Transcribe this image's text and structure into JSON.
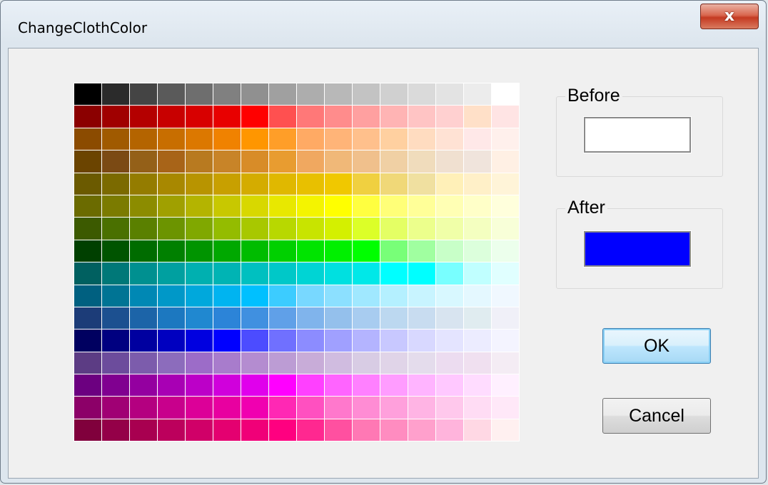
{
  "window": {
    "title": "ChangeClothColor",
    "close_icon": "x-icon",
    "close_glyph": "x"
  },
  "palette": {
    "rows": [
      [
        "#000000",
        "#2b2b2b",
        "#444444",
        "#5a5a5a",
        "#6e6e6e",
        "#808080",
        "#909090",
        "#a0a0a0",
        "#adadad",
        "#b8b8b8",
        "#c3c3c3",
        "#d0d0d0",
        "#dadada",
        "#e3e3e3",
        "#ececec",
        "#ffffff"
      ],
      [
        "#8b0000",
        "#a00000",
        "#b40000",
        "#c80000",
        "#d80000",
        "#e80000",
        "#ff0000",
        "#ff5050",
        "#ff7878",
        "#ff8c8c",
        "#ffa0a0",
        "#ffb4b4",
        "#ffc4c4",
        "#ffd0d0",
        "#ffe0c8",
        "#ffe4e4"
      ],
      [
        "#8b4b00",
        "#a05a00",
        "#b46400",
        "#c86e00",
        "#dc7800",
        "#f08200",
        "#ff9600",
        "#ff9e28",
        "#ffaa64",
        "#ffb478",
        "#ffc08c",
        "#ffd0a0",
        "#ffdcc0",
        "#ffe2d4",
        "#ffe8e8",
        "#fff0ec"
      ],
      [
        "#6b4400",
        "#7b4a14",
        "#946018",
        "#a86418",
        "#b87a20",
        "#c88428",
        "#d88c28",
        "#e89c30",
        "#f0a860",
        "#f0b878",
        "#f0c08c",
        "#f0d0a4",
        "#f0dcbc",
        "#f0e0d0",
        "#f0e4dc",
        "#fff0e4"
      ],
      [
        "#6b5a00",
        "#7b6a00",
        "#947c00",
        "#a88800",
        "#b89400",
        "#c8a000",
        "#d4ac00",
        "#e0b800",
        "#e8c000",
        "#f0c800",
        "#f0d040",
        "#f0d878",
        "#f0e0a0",
        "#fff0b8",
        "#fff0c8",
        "#fff4d8"
      ],
      [
        "#6b6b00",
        "#7b7b00",
        "#8c8c00",
        "#a0a000",
        "#b4b400",
        "#c8c800",
        "#d8d800",
        "#e8e800",
        "#f4f400",
        "#ffff00",
        "#ffff40",
        "#ffff78",
        "#ffff98",
        "#ffffb4",
        "#ffffc8",
        "#ffffdc"
      ],
      [
        "#3c5a00",
        "#4a7000",
        "#5a8000",
        "#6c9400",
        "#80a800",
        "#94bc00",
        "#a8c800",
        "#b8d800",
        "#c8e400",
        "#d4f000",
        "#dcff28",
        "#e4ff64",
        "#ecff8c",
        "#f0ffa8",
        "#f4ffc0",
        "#f8ffd8"
      ],
      [
        "#004000",
        "#005400",
        "#006c00",
        "#008000",
        "#009400",
        "#00a800",
        "#00bc00",
        "#00d000",
        "#00e400",
        "#00f000",
        "#00ff00",
        "#78ff78",
        "#a0ffa0",
        "#c8ffc8",
        "#dcffdc",
        "#ecffec"
      ],
      [
        "#006060",
        "#007878",
        "#009090",
        "#00a0a0",
        "#00b0b0",
        "#00b4b4",
        "#00c0c0",
        "#00c8c8",
        "#00d4d4",
        "#00e0e0",
        "#00e8e8",
        "#00ffff",
        "#00ffff",
        "#78ffff",
        "#c0ffff",
        "#e0ffff"
      ],
      [
        "#006080",
        "#007494",
        "#0088b4",
        "#0098c8",
        "#00a8dc",
        "#00b4f0",
        "#00c0ff",
        "#3cccff",
        "#78d8ff",
        "#8ce0ff",
        "#a0e8ff",
        "#b4f0ff",
        "#c8f4ff",
        "#d8f8ff",
        "#e4f8ff",
        "#f0f8ff"
      ],
      [
        "#1c3c78",
        "#1c5090",
        "#1c64a8",
        "#1c78c0",
        "#2088d0",
        "#2c84d8",
        "#4090e0",
        "#60a0e8",
        "#80b4ec",
        "#94c0ec",
        "#a8ccf0",
        "#bcd8f0",
        "#c8dcf0",
        "#d8e4f0",
        "#e0ecf0",
        "#f0f0f8"
      ],
      [
        "#000060",
        "#000080",
        "#0000a0",
        "#0000c0",
        "#0000e0",
        "#0000ff",
        "#4c4cff",
        "#7070ff",
        "#8c8cff",
        "#a0a0ff",
        "#b4b4ff",
        "#c8c8ff",
        "#d8d8ff",
        "#e4e4ff",
        "#ececff",
        "#f4f4ff"
      ],
      [
        "#5c3c84",
        "#6c4c9c",
        "#7c5cac",
        "#8c6cbc",
        "#9c6cc8",
        "#a87ccc",
        "#b48cd0",
        "#bc9cd4",
        "#c8acd8",
        "#d0bce0",
        "#d8cce4",
        "#e0d4e8",
        "#e4dcec",
        "#ecdcf0",
        "#f0e0f0",
        "#f4ecf4"
      ],
      [
        "#6c0080",
        "#800090",
        "#9400a0",
        "#a800b4",
        "#bc00c8",
        "#d000dc",
        "#e000ec",
        "#ff00ff",
        "#ff40ff",
        "#ff64ff",
        "#ff80ff",
        "#ff9cff",
        "#ffb4ff",
        "#ffc8ff",
        "#ffdcff",
        "#fff0ff"
      ],
      [
        "#8c0068",
        "#a00074",
        "#b40080",
        "#c8008c",
        "#dc0098",
        "#e800a0",
        "#f000b0",
        "#ff28b4",
        "#ff50c0",
        "#ff78cc",
        "#ff8cd4",
        "#ffa0dc",
        "#ffb4e4",
        "#ffc8ec",
        "#ffdcf4",
        "#ffe8f8"
      ],
      [
        "#80003c",
        "#940048",
        "#a80050",
        "#bc005c",
        "#d00068",
        "#e40070",
        "#f00078",
        "#ff0080",
        "#ff2890",
        "#ff50a0",
        "#ff78b4",
        "#ff8cc0",
        "#ffa0cc",
        "#ffb4dc",
        "#ffd8e4",
        "#fff0f0"
      ]
    ]
  },
  "before": {
    "label": "Before",
    "color": "#ffffff"
  },
  "after": {
    "label": "After",
    "color": "#0000ff"
  },
  "buttons": {
    "ok_label": "OK",
    "cancel_label": "Cancel"
  }
}
